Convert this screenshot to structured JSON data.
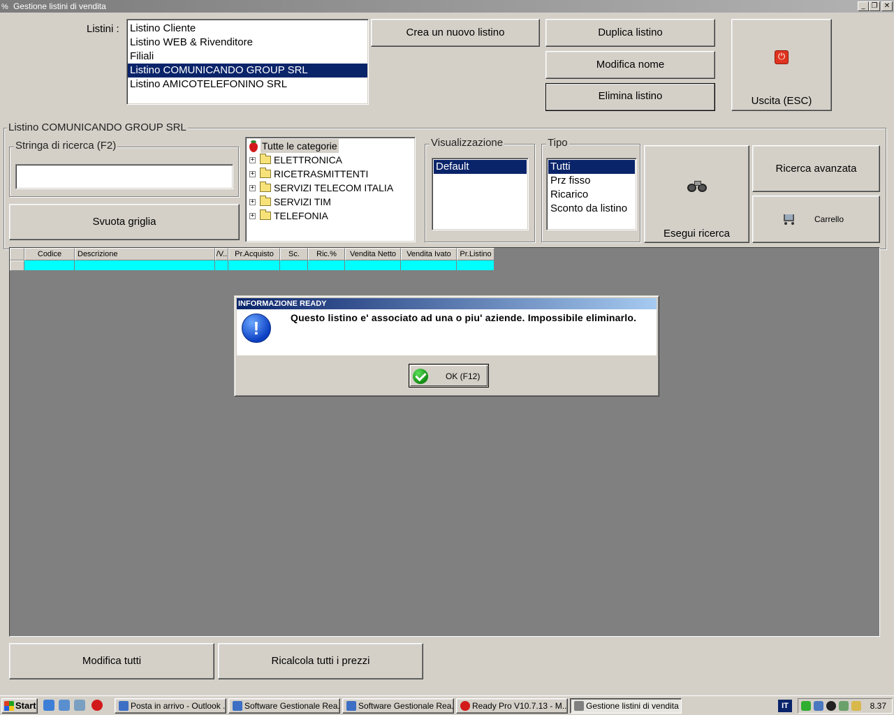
{
  "window": {
    "title": "Gestione listini di vendita",
    "minimize": "_",
    "restore": "❐",
    "close": "✕"
  },
  "listini": {
    "label": "Listini :",
    "items": [
      {
        "label": "Listino Cliente",
        "selected": false
      },
      {
        "label": "Listino WEB & Rivenditore",
        "selected": false
      },
      {
        "label": "Filiali",
        "selected": false
      },
      {
        "label": "Listino COMUNICANDO GROUP SRL",
        "selected": true
      },
      {
        "label": "Listino AMICOTELEFONINO SRL",
        "selected": false
      }
    ]
  },
  "actions": {
    "create": "Crea un nuovo listino",
    "duplicate": "Duplica listino",
    "rename": "Modifica nome",
    "delete": "Elimina listino",
    "exit": "Uscita (ESC)"
  },
  "panel": {
    "title": "Listino COMUNICANDO GROUP SRL",
    "search": {
      "legend": "Stringa di ricerca (F2)",
      "value": "",
      "clear_button": "Svuota griglia"
    },
    "categories": {
      "root": "Tutte le categorie",
      "items": [
        "ELETTRONICA",
        "RICETRASMITTENTI",
        "SERVIZI TELECOM ITALIA",
        "SERVIZI TIM",
        "TELEFONIA"
      ]
    },
    "view": {
      "legend": "Visualizzazione",
      "items": [
        {
          "label": "Default",
          "selected": true
        }
      ]
    },
    "type": {
      "legend": "Tipo",
      "items": [
        {
          "label": "Tutti",
          "selected": true
        },
        {
          "label": "Prz fisso",
          "selected": false
        },
        {
          "label": "Ricarico",
          "selected": false
        },
        {
          "label": "Sconto da listino",
          "selected": false
        }
      ]
    },
    "run_search": "Esegui ricerca",
    "advanced_search": "Ricerca avanzata",
    "cart": "Carrello"
  },
  "grid": {
    "columns": [
      "Codice",
      "Descrizione",
      "/V..",
      "Pr.Acquisto",
      "Sc.",
      "Ric.%",
      "Vendita Netto",
      "Vendita Ivato",
      "Pr.Listino"
    ],
    "row_color": "#00ffff"
  },
  "dialog": {
    "title": "INFORMAZIONE READY",
    "message": "Questo listino e' associato ad una o piu' aziende. Impossibile eliminarlo.",
    "ok": "OK (F12)"
  },
  "bottom": {
    "edit_all": "Modifica tutti",
    "recalc_all": "Ricalcola tutti i prezzi"
  },
  "taskbar": {
    "start": "Start",
    "tasks": [
      {
        "label": "Posta in arrivo - Outlook ...",
        "active": false,
        "color": "#3d6fc4"
      },
      {
        "label": "Software Gestionale Rea...",
        "active": false,
        "color": "#3d6fc4"
      },
      {
        "label": "Software Gestionale Rea...",
        "active": false,
        "color": "#3d6fc4"
      },
      {
        "label": "Ready Pro V10.7.13 - M...",
        "active": false,
        "color": "#d21a1a"
      },
      {
        "label": "Gestione listini di vendita",
        "active": true,
        "color": "#808080"
      }
    ],
    "language": "IT",
    "clock": "8.37"
  }
}
